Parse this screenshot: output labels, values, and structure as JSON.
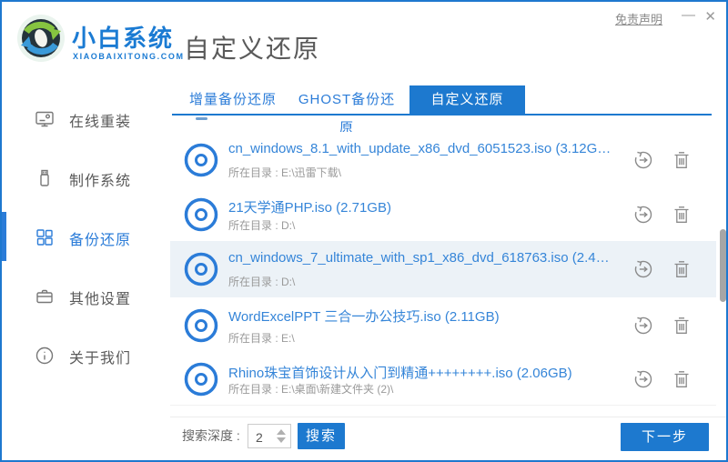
{
  "window": {
    "disclaimer_link": "免责声明",
    "minimize_glyph": "—",
    "close_glyph": "✕"
  },
  "header": {
    "brand_name": "小白系统",
    "brand_domain": "XIAOBAIXITONG.COM",
    "page_title": "自定义还原"
  },
  "sidebar": {
    "items": [
      {
        "label": "在线重装",
        "icon": "monitor-icon",
        "active": false
      },
      {
        "label": "制作系统",
        "icon": "usb-drive-icon",
        "active": false
      },
      {
        "label": "备份还原",
        "icon": "blocks-icon",
        "active": true
      },
      {
        "label": "其他设置",
        "icon": "briefcase-icon",
        "active": false
      },
      {
        "label": "关于我们",
        "icon": "info-icon",
        "active": false
      }
    ]
  },
  "tabs": [
    {
      "label": "增量备份还原",
      "active": false
    },
    {
      "label": "GHOST备份还原",
      "active": false
    },
    {
      "label": "自定义还原",
      "active": true
    }
  ],
  "file_list": [
    {
      "title": "cn_windows_8.1_with_update_x86_dvd_6051523.iso (3.12G…",
      "directory": "所在目录 : E:\\迅雷下载\\",
      "highlighted": false
    },
    {
      "title": "21天学通PHP.iso (2.71GB)",
      "directory": "所在目录 : D:\\",
      "highlighted": false
    },
    {
      "title": "cn_windows_7_ultimate_with_sp1_x86_dvd_618763.iso (2.4…",
      "directory": "所在目录 : D:\\",
      "highlighted": true
    },
    {
      "title": "WordExcelPPT 三合一办公技巧.iso (2.11GB)",
      "directory": "所在目录 : E:\\",
      "highlighted": false
    },
    {
      "title": "Rhino珠宝首饰设计从入门到精通++++++++.iso (2.06GB)",
      "directory": "所在目录 : E:\\桌面\\新建文件夹 (2)\\",
      "highlighted": false
    }
  ],
  "footer": {
    "search_depth_label": "搜索深度 :",
    "search_depth_value": "2",
    "search_button_label": "搜索",
    "next_button_label": "下一步"
  },
  "colors": {
    "primary_blue": "#1d79cf",
    "link_blue": "#3585d8",
    "sidebar_active_blue": "#2b7cd8",
    "highlight_row": "#ecf2f7",
    "window_border": "#1e78cf"
  }
}
